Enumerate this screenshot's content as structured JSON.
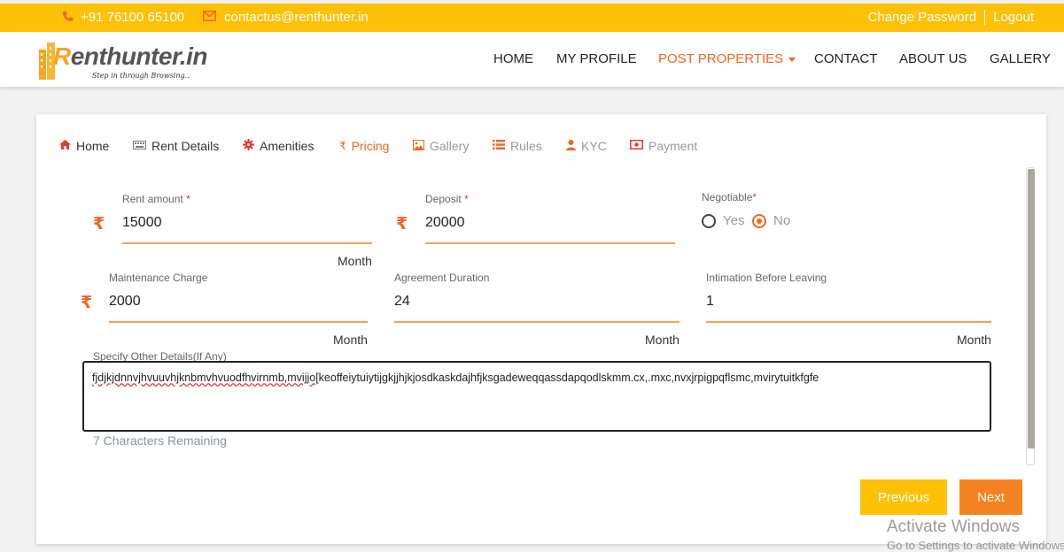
{
  "topbar": {
    "phone": "+91 76100 65100",
    "email": "contactus@renthunter.in",
    "change_password": "Change Password",
    "logout": "Logout"
  },
  "logo": {
    "text_r": "R",
    "text_rest": "enthunter.in",
    "tagline": "Step in through Browsing.."
  },
  "nav": {
    "home": "HOME",
    "profile": "MY PROFILE",
    "post": "POST PROPERTIES",
    "contact": "CONTACT",
    "about": "ABOUT US",
    "gallery": "GALLERY"
  },
  "tabs": {
    "home": "Home",
    "rent_details": "Rent Details",
    "amenities": "Amenities",
    "pricing": "Pricing",
    "gallery": "Gallery",
    "rules": "Rules",
    "kyc": "KYC",
    "payment": "Payment"
  },
  "form": {
    "rupee": "₹",
    "required": "*",
    "rent_label": "Rent amount",
    "rent_value": "15000",
    "deposit_label": "Deposit",
    "deposit_value": "20000",
    "negotiable_label": "Negotiable",
    "yes": "Yes",
    "no": "No",
    "month": "Month",
    "maintenance_label": "Maintenance Charge",
    "maintenance_value": "2000",
    "duration_label": "Agreement Duration",
    "duration_value": "24",
    "intimation_label": "Intimation Before Leaving",
    "intimation_value": "1",
    "other_label": "Specify Other Details(If Any)",
    "other_value_a": "fjdjkjdnnvjhvuuvhjknbmvhvuodfhvirnmb,mvijjo[",
    "other_value_b": "keoffeiytuiytijgkjjhjkjosdkaskdajhfjksgadeweqqassdapqodlskmm.cx,.mxc,nvxjrpigpqflsmc,mvirytuitkfgfe",
    "remaining": "7 Characters Remaining"
  },
  "buttons": {
    "previous": "Previous",
    "next": "Next"
  },
  "watermark": {
    "line1": "Activate Windows",
    "line2": "Go to Settings to activate Windows."
  },
  "colors": {
    "accent": "#f26522",
    "yellow": "#ffc107"
  }
}
